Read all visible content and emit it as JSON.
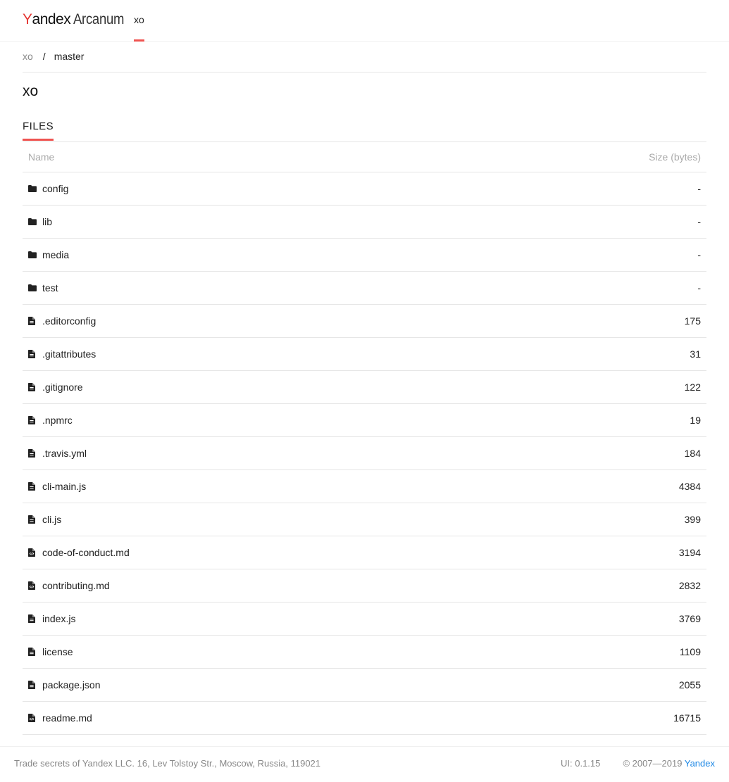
{
  "header": {
    "logo_first": "Y",
    "logo_rest": "andex",
    "logo_product": "Arcanum",
    "nav_tab": "xo"
  },
  "breadcrumb": {
    "repo": "xo",
    "separator": "/",
    "branch": "master"
  },
  "page_title": "xo",
  "tabs": {
    "files": "FILES"
  },
  "table": {
    "columns": {
      "name": "Name",
      "size": "Size (bytes)"
    },
    "rows": [
      {
        "type": "folder",
        "icon": "folder-icon",
        "name": "config",
        "size": "-"
      },
      {
        "type": "folder",
        "icon": "folder-icon",
        "name": "lib",
        "size": "-"
      },
      {
        "type": "folder",
        "icon": "folder-icon",
        "name": "media",
        "size": "-"
      },
      {
        "type": "folder",
        "icon": "folder-icon",
        "name": "test",
        "size": "-"
      },
      {
        "type": "file",
        "icon": "file-text-icon",
        "name": ".editorconfig",
        "size": "175"
      },
      {
        "type": "file",
        "icon": "file-text-icon",
        "name": ".gitattributes",
        "size": "31"
      },
      {
        "type": "file",
        "icon": "file-text-icon",
        "name": ".gitignore",
        "size": "122"
      },
      {
        "type": "file",
        "icon": "file-text-icon",
        "name": ".npmrc",
        "size": "19"
      },
      {
        "type": "file",
        "icon": "file-text-icon",
        "name": ".travis.yml",
        "size": "184"
      },
      {
        "type": "file",
        "icon": "file-text-icon",
        "name": "cli-main.js",
        "size": "4384"
      },
      {
        "type": "file",
        "icon": "file-text-icon",
        "name": "cli.js",
        "size": "399"
      },
      {
        "type": "file",
        "icon": "file-code-icon",
        "name": "code-of-conduct.md",
        "size": "3194"
      },
      {
        "type": "file",
        "icon": "file-code-icon",
        "name": "contributing.md",
        "size": "2832"
      },
      {
        "type": "file",
        "icon": "file-text-icon",
        "name": "index.js",
        "size": "3769"
      },
      {
        "type": "file",
        "icon": "file-text-icon",
        "name": "license",
        "size": "1109"
      },
      {
        "type": "file",
        "icon": "file-text-icon",
        "name": "package.json",
        "size": "2055"
      },
      {
        "type": "file",
        "icon": "file-code-icon",
        "name": "readme.md",
        "size": "16715"
      }
    ]
  },
  "footer": {
    "legal": "Trade secrets of Yandex LLC. 16, Lev Tolstoy Str., Moscow, Russia, 119021",
    "ui_version": "UI: 0.1.15",
    "copyright": "© 2007—2019",
    "company_link": "Yandex"
  },
  "colors": {
    "accent": "#ef5350",
    "link": "#1e88e5",
    "muted": "#888888"
  }
}
